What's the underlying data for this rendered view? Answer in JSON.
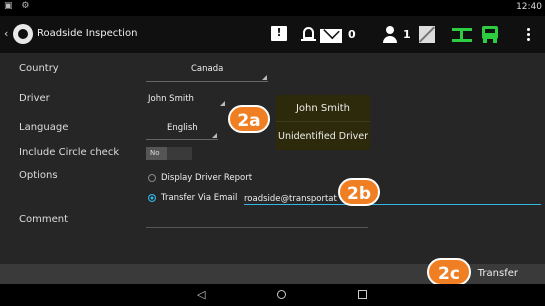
{
  "status_bar": {
    "left_icons": [
      "image-icon",
      "settings-icon"
    ],
    "time": "12:40"
  },
  "app_bar": {
    "title": "Roadside Inspection",
    "mail_count": "0",
    "user_count": "1",
    "alert_glyph": "!",
    "icons": [
      "alert-icon",
      "bell-icon",
      "mail-icon",
      "person-icon",
      "document-icon",
      "gps-icon",
      "truck-icon",
      "more-icon"
    ],
    "accent_color": "#2ecc40"
  },
  "form": {
    "country_label": "Country",
    "country_value": "Canada",
    "driver_label": "Driver",
    "driver_value": "John Smith",
    "language_label": "Language",
    "language_value": "English",
    "circle_check_label": "Include Circle check",
    "circle_check_value": "No",
    "options_label": "Options",
    "option_display": "Display Driver Report",
    "option_transfer": "Transfer Via Email",
    "email_value": "roadside@transportat",
    "comment_label": "Comment"
  },
  "driver_dropdown": {
    "options": [
      "John Smith",
      "Unidentified Driver"
    ]
  },
  "footer": {
    "transfer_label": "Transfer"
  },
  "annotations": {
    "badge_2a": "2a",
    "badge_2b": "2b",
    "badge_2c": "2c",
    "color": "#f07f23"
  }
}
